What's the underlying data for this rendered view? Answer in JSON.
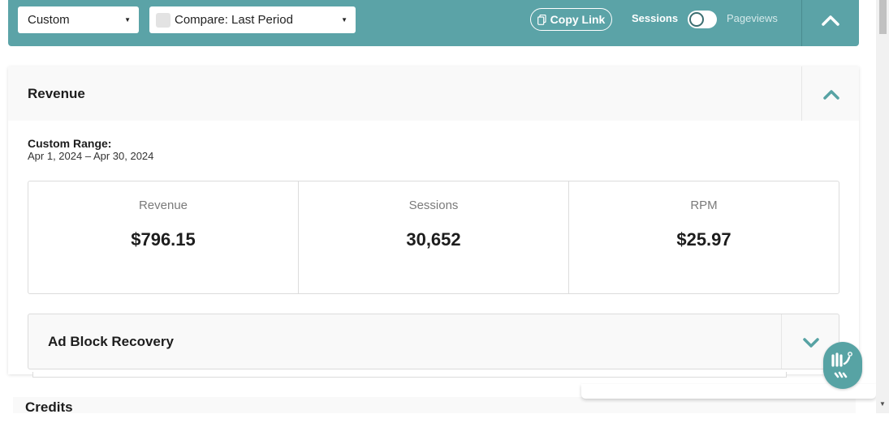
{
  "toolbar": {
    "range_select": "Custom",
    "compare_select": "Compare: Last Period",
    "copy_link": "Copy Link",
    "sessions_label": "Sessions",
    "pageviews_label": "Pageviews",
    "collapse_icon": "chevron-up-icon"
  },
  "revenue_card": {
    "title": "Revenue",
    "collapse_icon": "chevron-up-icon",
    "range_label": "Custom Range:",
    "range_value": "Apr 1, 2024 – Apr 30, 2024",
    "metrics": [
      {
        "label": "Revenue",
        "value": "$796.15"
      },
      {
        "label": "Sessions",
        "value": "30,652"
      },
      {
        "label": "RPM",
        "value": "$25.97"
      }
    ]
  },
  "ad_block_recovery": {
    "title": "Ad Block Recovery",
    "expand_icon": "chevron-down-icon"
  },
  "credits_card": {
    "title": "Credits"
  },
  "colors": {
    "toolbar_bg": "#5ba3a7",
    "accent_teal": "#57a3a4",
    "header_bg": "#f9f9f9"
  }
}
